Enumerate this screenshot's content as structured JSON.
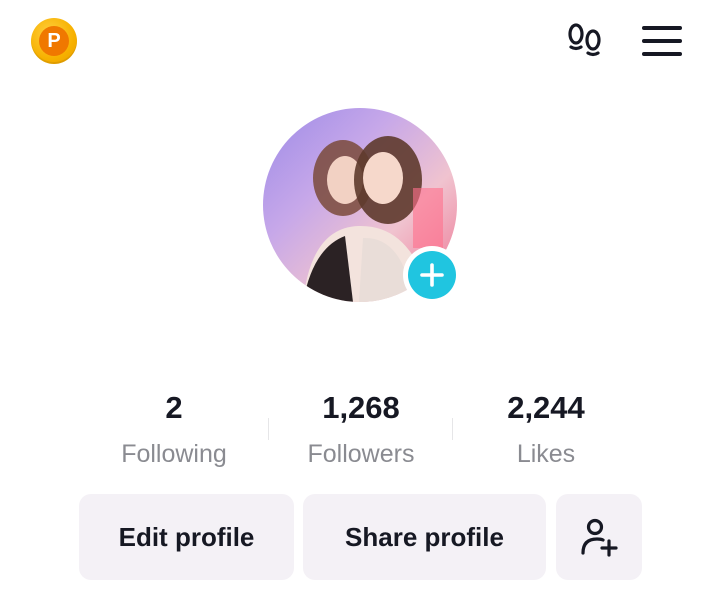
{
  "header": {
    "coin_letter": "P",
    "footprint_icon": "footprint-icon",
    "menu_icon": "hamburger-menu-icon"
  },
  "profile": {
    "avatar": "profile-photo",
    "add_icon": "plus-icon"
  },
  "stats": [
    {
      "value": "2",
      "label": "Following"
    },
    {
      "value": "1,268",
      "label": "Followers"
    },
    {
      "value": "2,244",
      "label": "Likes"
    }
  ],
  "actions": {
    "edit_label": "Edit profile",
    "share_label": "Share profile",
    "add_friend_icon": "add-friend-icon"
  },
  "colors": {
    "accent": "#20c5e0",
    "coin": "#f7b100",
    "button_bg": "#f4f1f6",
    "secondary_text": "#8a8b91"
  }
}
